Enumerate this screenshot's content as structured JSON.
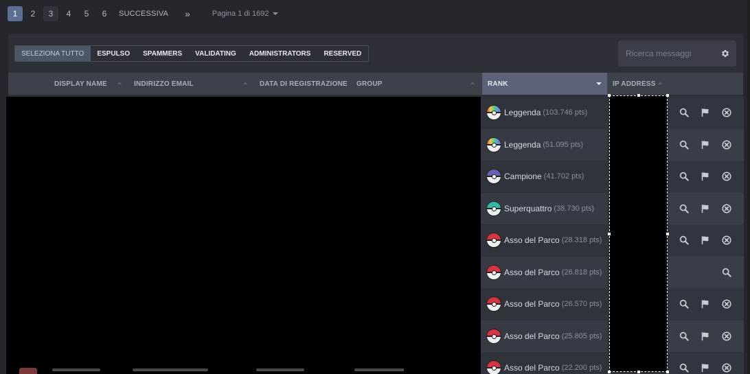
{
  "pagination": {
    "pages": [
      "1",
      "2",
      "3",
      "4",
      "5",
      "6"
    ],
    "current": "1",
    "next_label": "SUCCESSIVA",
    "last_label": "»",
    "page_info": "Pagina 1 di 1692"
  },
  "filters": [
    "SELEZIONA TUTTO",
    "ESPULSO",
    "SPAMMERS",
    "VALIDATING",
    "ADMINISTRATORS",
    "RESERVED"
  ],
  "search": {
    "placeholder": "Ricerca messaggi"
  },
  "table": {
    "headers": {
      "display_name": "DISPLAY NAME",
      "email": "INDIRIZZO EMAIL",
      "registration_date": "DATA DI REGISTRAZIONE",
      "group": "GROUP",
      "rank": "RANK",
      "ip_address": "IP ADDRESS"
    },
    "rows": [
      {
        "rank": "Leggenda",
        "points": "(103.746 pts)",
        "ball": "rainbow",
        "actions": [
          "search",
          "flag",
          "remove"
        ]
      },
      {
        "rank": "Leggenda",
        "points": "(51.095 pts)",
        "ball": "rainbow",
        "actions": [
          "search",
          "flag",
          "remove"
        ]
      },
      {
        "rank": "Campione",
        "points": "(41.702 pts)",
        "ball": "master",
        "actions": [
          "search",
          "flag",
          "remove"
        ]
      },
      {
        "rank": "Superquattro",
        "points": "(38.730 pts)",
        "ball": "teal",
        "actions": [
          "search",
          "flag",
          "remove"
        ]
      },
      {
        "rank": "Asso del Parco",
        "points": "(28.318 pts)",
        "ball": "poke",
        "actions": [
          "search",
          "flag",
          "remove"
        ]
      },
      {
        "rank": "Asso del Parco",
        "points": "(26.818 pts)",
        "ball": "poke",
        "actions": [
          "search"
        ]
      },
      {
        "rank": "Asso del Parco",
        "points": "(26.570 pts)",
        "ball": "poke",
        "actions": [
          "search",
          "flag",
          "remove"
        ]
      },
      {
        "rank": "Asso del Parco",
        "points": "(25.805 pts)",
        "ball": "poke",
        "actions": [
          "search",
          "flag",
          "remove"
        ]
      },
      {
        "rank": "Asso del Parco",
        "points": "(22.200 pts)",
        "ball": "poke",
        "actions": [
          "search",
          "flag",
          "remove"
        ]
      }
    ]
  },
  "colors": {
    "accent": "#5b6f93",
    "rank_header": "#5c6378",
    "ball_poke": "#d8333f",
    "ball_master": "#6b5fb8",
    "ball_teal": "#2fb7a8"
  },
  "icons": {
    "search": "magnifier-icon",
    "flag": "flag-icon",
    "remove": "close-circle-icon",
    "settings": "gear-icon"
  }
}
